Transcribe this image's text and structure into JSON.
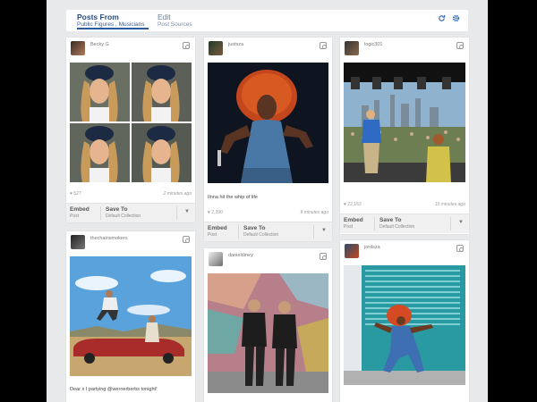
{
  "tabs": {
    "posts_title": "Posts From",
    "posts_sub": "Public Figures , Musicians",
    "edit_title": "Edit",
    "edit_sub": "Post Sources"
  },
  "icons": {
    "refresh": "refresh-icon",
    "settings": "gear-icon"
  },
  "actions": {
    "embed": "Embed",
    "embed_sub": "Post",
    "save": "Save To",
    "save_sub": "Default Collection"
  },
  "posts": [
    {
      "user": "Becky G",
      "likes": "♥ 527",
      "time": "2 minutes ago",
      "caption": ""
    },
    {
      "user": "justsza",
      "likes": "♥ 2,390",
      "time": "8 minutes ago",
      "caption": "Ilnna hit the whip of life"
    },
    {
      "user": "logic301",
      "likes": "♥ 22,163",
      "time": "15 minutes ago",
      "caption": ""
    },
    {
      "user": "thechainsmokers",
      "likes": "",
      "time": "",
      "caption": "Dear x I partying @wernerberbs tonight!"
    },
    {
      "user": "danieldiney",
      "likes": "",
      "time": "",
      "caption": ""
    },
    {
      "user": "jordsza",
      "likes": "",
      "time": "",
      "caption": ""
    }
  ],
  "colors": {
    "accent": "#2c5a9c",
    "background": "#e8e9eb"
  }
}
